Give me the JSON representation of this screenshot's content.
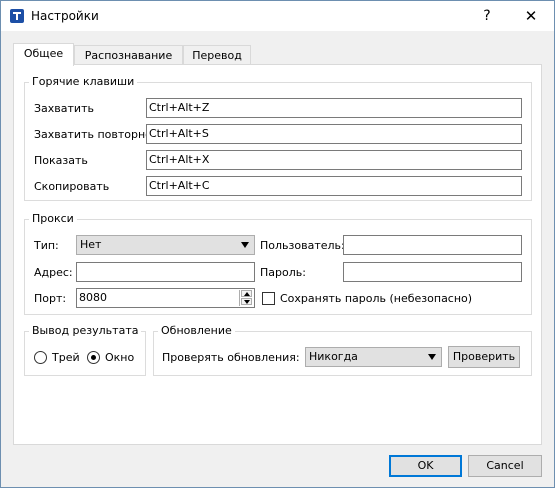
{
  "window": {
    "title": "Настройки",
    "help_label": "?",
    "close_label": "✕"
  },
  "tabs": [
    {
      "label": "Общее"
    },
    {
      "label": "Распознавание"
    },
    {
      "label": "Перевод"
    }
  ],
  "hotkeys": {
    "title": "Горячие клавиши",
    "items": [
      {
        "label": "Захватить",
        "value": "Ctrl+Alt+Z"
      },
      {
        "label": "Захватить повторно",
        "value": "Ctrl+Alt+S"
      },
      {
        "label": "Показать",
        "value": "Ctrl+Alt+X"
      },
      {
        "label": "Скопировать",
        "value": "Ctrl+Alt+C"
      }
    ]
  },
  "proxy": {
    "title": "Прокси",
    "type_label": "Тип:",
    "type_value": "Нет",
    "user_label": "Пользователь:",
    "user_value": "",
    "address_label": "Адрес:",
    "address_value": "",
    "password_label": "Пароль:",
    "password_value": "",
    "port_label": "Порт:",
    "port_value": "8080",
    "save_password_label": "Сохранять пароль (небезопасно)"
  },
  "output": {
    "title": "Вывод результата",
    "tray_label": "Трей",
    "window_label": "Окно",
    "selected": "Окно"
  },
  "update": {
    "title": "Обновление",
    "check_label": "Проверять обновления:",
    "check_value": "Никогда",
    "check_button": "Проверить"
  },
  "footer": {
    "ok_label": "OK",
    "cancel_label": "Cancel"
  }
}
